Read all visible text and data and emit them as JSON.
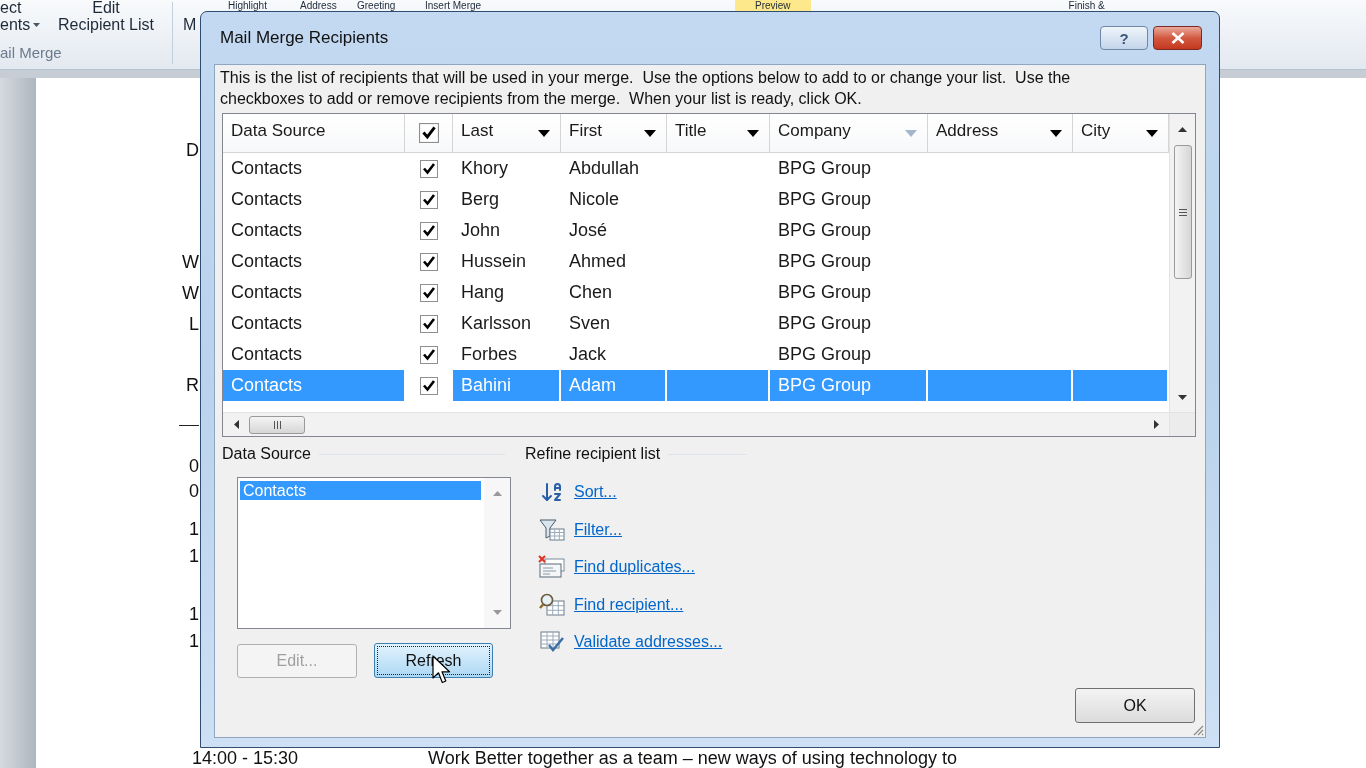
{
  "ribbon": {
    "buttons": [
      {
        "lines": [
          "ect",
          "ents"
        ],
        "dropdown": true
      },
      {
        "lines": [
          "Edit",
          "Recipient List"
        ],
        "dropdown": false
      }
    ],
    "group_label": "ail Merge",
    "cut_button": "M",
    "top_row": [
      {
        "text": "Highlight",
        "highlighted": false
      },
      {
        "text": "Address",
        "highlighted": false
      },
      {
        "text": "Greeting",
        "highlighted": false
      },
      {
        "text": "Insert Merge",
        "highlighted": false
      },
      {
        "text": "Preview",
        "highlighted": true
      },
      {
        "text": "Finish &",
        "highlighted": false
      }
    ]
  },
  "document": {
    "fragments": [
      "D",
      "W",
      "W",
      "L",
      "R",
      "0",
      "0",
      "1",
      "1",
      "1",
      "1"
    ],
    "bottom_line": [
      "14:00 - 15:30",
      "Work Better together as a team – new ways of using technology to"
    ]
  },
  "dialog": {
    "title": "Mail Merge Recipients",
    "help_label": "?",
    "intro": [
      "This is the list of recipients that will be used in your merge.  Use the options below to add to or change your list.  Use the",
      "checkboxes to add or remove recipients from the merge.  When your list is ready, click OK."
    ],
    "table": {
      "columns": [
        {
          "kind": "text",
          "label": "Data Source"
        },
        {
          "kind": "checkbox",
          "checked": true
        },
        {
          "kind": "filter",
          "label": "Last",
          "dimmed": false
        },
        {
          "kind": "filter",
          "label": "First",
          "dimmed": false
        },
        {
          "kind": "filter",
          "label": "Title",
          "dimmed": false
        },
        {
          "kind": "filter",
          "label": "Company",
          "dimmed": true
        },
        {
          "kind": "filter",
          "label": "Address",
          "dimmed": false
        },
        {
          "kind": "filter",
          "label": "City",
          "dimmed": false
        }
      ],
      "rows": [
        {
          "data_source": "Contacts",
          "checked": true,
          "last": "Khory",
          "first": "Abdullah",
          "company": "BPG Group",
          "selected": false
        },
        {
          "data_source": "Contacts",
          "checked": true,
          "last": "Berg",
          "first": "Nicole",
          "company": "BPG Group",
          "selected": false
        },
        {
          "data_source": "Contacts",
          "checked": true,
          "last": "John",
          "first": "José",
          "company": "BPG Group",
          "selected": false
        },
        {
          "data_source": "Contacts",
          "checked": true,
          "last": "Hussein",
          "first": "Ahmed",
          "company": "BPG Group",
          "selected": false
        },
        {
          "data_source": "Contacts",
          "checked": true,
          "last": "Hang",
          "first": "Chen",
          "company": "BPG Group",
          "selected": false
        },
        {
          "data_source": "Contacts",
          "checked": true,
          "last": "Karlsson",
          "first": "Sven",
          "company": "BPG Group",
          "selected": false
        },
        {
          "data_source": "Contacts",
          "checked": true,
          "last": "Forbes",
          "first": "Jack",
          "company": "BPG Group",
          "selected": false
        },
        {
          "data_source": "Contacts",
          "checked": true,
          "last": "Bahini",
          "first": "Adam",
          "company": "BPG Group",
          "selected": true
        }
      ]
    },
    "data_source": {
      "label": "Data Source",
      "items": [
        {
          "label": "Contacts",
          "selected": true
        }
      ],
      "buttons": [
        {
          "label": "Edit...",
          "disabled": true,
          "focused": false
        },
        {
          "label": "Refresh",
          "disabled": false,
          "focused": true
        }
      ]
    },
    "refine": {
      "label": "Refine recipient list",
      "links": [
        "Sort...",
        "Filter...",
        "Find duplicates...",
        "Find recipient...",
        "Validate addresses..."
      ]
    },
    "ok_button": {
      "label": "OK",
      "disabled": false,
      "focused": false
    }
  }
}
